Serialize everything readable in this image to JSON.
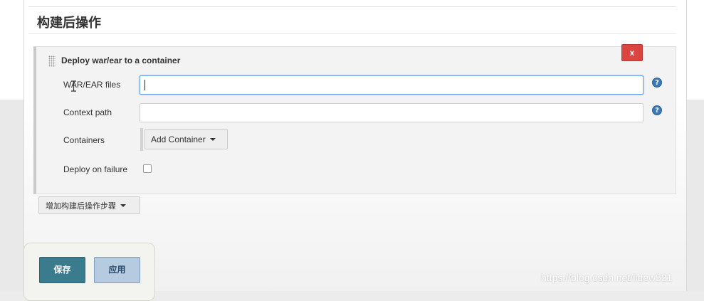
{
  "section": {
    "title": "构建后操作"
  },
  "step": {
    "title": "Deploy war/ear to a container",
    "delete_label": "x",
    "fields": {
      "war_files": {
        "label": "WAR/EAR files",
        "value": ""
      },
      "context_path": {
        "label": "Context path",
        "value": ""
      },
      "containers": {
        "label": "Containers",
        "button": "Add Container"
      },
      "deploy_on_failure": {
        "label": "Deploy on failure",
        "checked": false
      }
    },
    "help_icon": "?"
  },
  "add_step_button": "增加构建后操作步骤",
  "buttons": {
    "save": "保存",
    "apply": "应用"
  },
  "watermark": "https://blog.csdn.net/lidew521",
  "colors": {
    "delete": "#d9453f",
    "save": "#3a7c8e",
    "apply": "#b7cbe0",
    "help": "#3b79b8"
  },
  "icons": {
    "drag": "drag-handle-icon",
    "help": "help-icon",
    "dropdown": "chevron-down-icon",
    "cursor": "text-cursor-icon"
  }
}
